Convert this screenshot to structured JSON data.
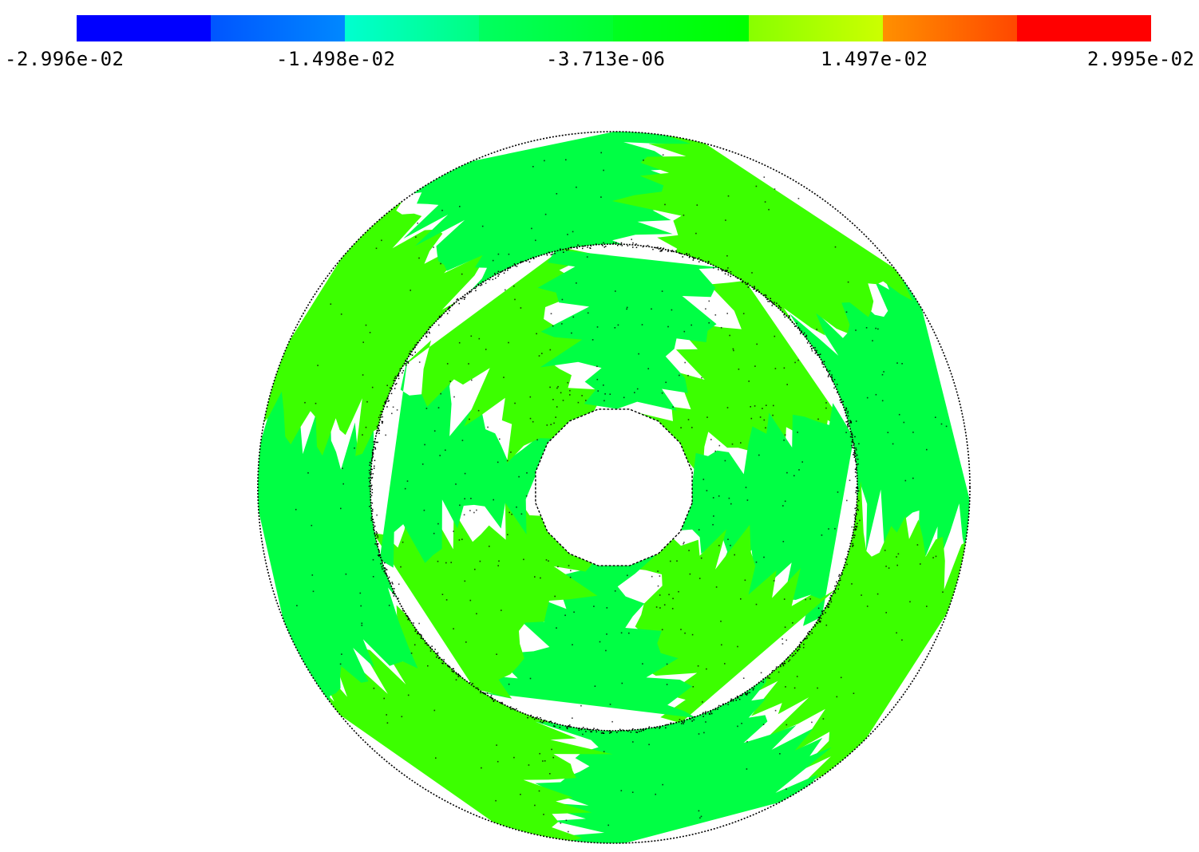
{
  "colorbar": {
    "colors": [
      "#0000ff",
      "#0060ff",
      "#00ffd0",
      "#00ff50",
      "#00ff00",
      "#00ff40",
      "#90ff00",
      "#ff8000",
      "#ff0000"
    ],
    "gradients": [
      [
        "#0000ff",
        "#0000ff"
      ],
      [
        "#0055ff",
        "#0088ff"
      ],
      [
        "#00ffd0",
        "#00ff80"
      ],
      [
        "#00ff60",
        "#00ff30"
      ],
      [
        "#00ff20",
        "#00ff00"
      ],
      [
        "#00ff20",
        "#20ff30"
      ],
      [
        "#88ff00",
        "#ccff00"
      ],
      [
        "#ff9000",
        "#ff4800"
      ],
      [
        "#ff0000",
        "#ff0000"
      ]
    ],
    "tick_labels": [
      "-2.996e-02",
      "-1.498e-02",
      "-3.713e-06",
      "1.497e-02",
      "2.995e-02"
    ]
  },
  "diagram": {
    "shade_a": "#3cff00",
    "shade_b": "#00ff44",
    "outline_color": "#000000",
    "sector_count": 8
  }
}
